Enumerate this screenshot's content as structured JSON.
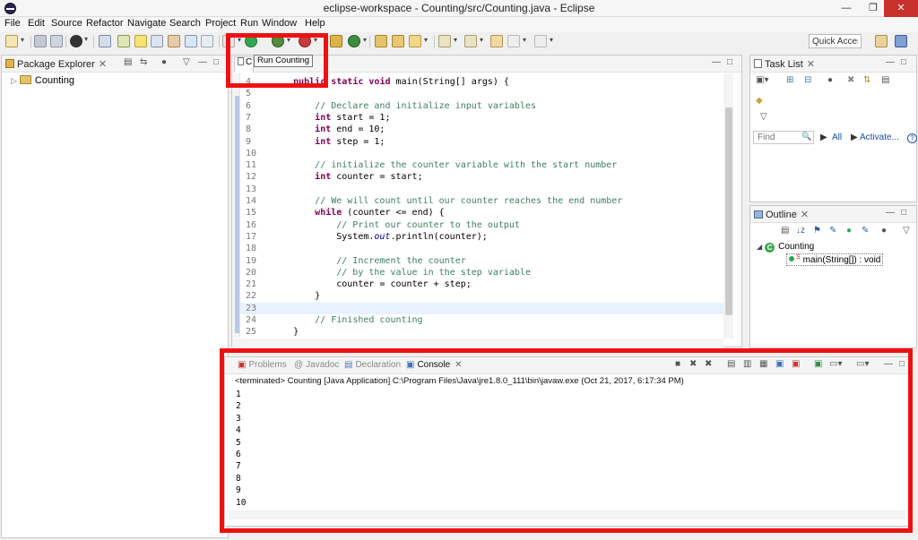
{
  "window": {
    "title": "eclipse-workspace - Counting/src/Counting.java - Eclipse",
    "min": "—",
    "max": "❐",
    "close": "✕"
  },
  "menu": [
    "File",
    "Edit",
    "Source",
    "Refactor",
    "Navigate",
    "Search",
    "Project",
    "Run",
    "Window",
    "Help"
  ],
  "toolbar": {
    "quick_access": "Quick Access"
  },
  "tooltip": "Run Counting",
  "package_explorer": {
    "title": "Package Explorer",
    "project": "Counting"
  },
  "editor": {
    "tab": "C",
    "lines": [
      {
        "n": "4",
        "text": "    public static void main(String[] args) {"
      },
      {
        "n": "5",
        "text": ""
      },
      {
        "n": "6",
        "text": "        // Declare and initialize input variables"
      },
      {
        "n": "7",
        "text": "        int start = 1;"
      },
      {
        "n": "8",
        "text": "        int end = 10;"
      },
      {
        "n": "9",
        "text": "        int step = 1;"
      },
      {
        "n": "10",
        "text": ""
      },
      {
        "n": "11",
        "text": "        // initialize the counter variable with the start number"
      },
      {
        "n": "12",
        "text": "        int counter = start;"
      },
      {
        "n": "13",
        "text": ""
      },
      {
        "n": "14",
        "text": "        // We will count until our counter reaches the end number"
      },
      {
        "n": "15",
        "text": "        while (counter <= end) {"
      },
      {
        "n": "16",
        "text": "            // Print our counter to the output"
      },
      {
        "n": "17",
        "text": "            System.out.println(counter);"
      },
      {
        "n": "18",
        "text": ""
      },
      {
        "n": "19",
        "text": "            // Increment the counter"
      },
      {
        "n": "20",
        "text": "            // by the value in the step variable"
      },
      {
        "n": "21",
        "text": "            counter = counter + step;"
      },
      {
        "n": "22",
        "text": "        }"
      },
      {
        "n": "23",
        "text": ""
      },
      {
        "n": "24",
        "text": "        // Finished counting"
      },
      {
        "n": "25",
        "text": "    }"
      }
    ],
    "highlighted_line": "23"
  },
  "task_list": {
    "title": "Task List",
    "find_placeholder": "Find",
    "all": "All",
    "activate": "Activate...",
    "help": "?"
  },
  "outline": {
    "title": "Outline",
    "class_name": "Counting",
    "method": "main(String[]) : void"
  },
  "console": {
    "tabs": [
      "Problems",
      "Javadoc",
      "Declaration",
      "Console"
    ],
    "active_tab": "Console",
    "status": "<terminated> Counting [Java Application] C:\\Program Files\\Java\\jre1.8.0_111\\bin\\javaw.exe (Oct 21, 2017, 6:17:34 PM)",
    "output": [
      "1",
      "2",
      "3",
      "4",
      "5",
      "6",
      "7",
      "8",
      "9",
      "10"
    ]
  },
  "colors": {
    "highlight_box": "#ee1111",
    "keyword": "#7f0055",
    "comment": "#3f7f5f",
    "field": "#0000c0"
  }
}
